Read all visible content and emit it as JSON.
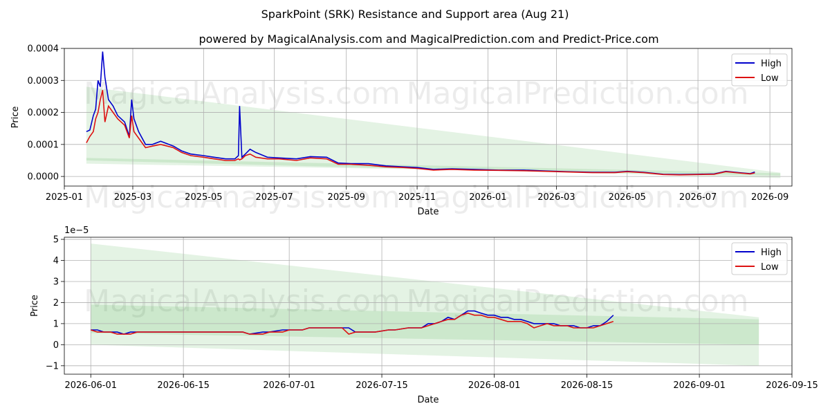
{
  "title": "SparkPoint (SRK) Resistance and Support area (Aug 21)",
  "subtitle": "powered by MagicalAnalysis.com and MagicalPrediction.com and Predict-Price.com",
  "watermarks": [
    "MagicalAnalysis.com",
    "MagicalPrediction.com"
  ],
  "colors": {
    "high": "#0000cc",
    "low": "#dd1111",
    "band": "#2ca02c",
    "grid": "#b0b0b0"
  },
  "chart_data": [
    {
      "type": "line",
      "xlabel": "Date",
      "ylabel": "Price",
      "grid": true,
      "legend": "top-right",
      "xlim": [
        "2025-01-01",
        "2026-09-20"
      ],
      "ylim": [
        -3e-05,
        0.0004
      ],
      "xticks": [
        "2025-01",
        "2025-03",
        "2025-05",
        "2025-07",
        "2025-09",
        "2025-11",
        "2026-01",
        "2026-03",
        "2026-05",
        "2026-07",
        "2026-09"
      ],
      "yticks": [
        {
          "value": 0.0,
          "label": "0.0000"
        },
        {
          "value": 0.0001,
          "label": "0.0001"
        },
        {
          "value": 0.0002,
          "label": "0.0002"
        },
        {
          "value": 0.0003,
          "label": "0.0003"
        },
        {
          "value": 0.0004,
          "label": "0.0004"
        }
      ],
      "bands": [
        {
          "x": [
            "2025-01-20",
            "2026-09-10"
          ],
          "upper": [
            0.00028,
            1.2e-05
          ],
          "lower": [
            5e-05,
            -5e-06
          ]
        },
        {
          "x": [
            "2025-01-20",
            "2026-09-10"
          ],
          "upper": [
            5.8e-05,
            1e-05
          ],
          "lower": [
            4e-05,
            3e-06
          ]
        }
      ],
      "series": [
        {
          "name": "High",
          "x": [
            "2025-01-20",
            "2025-01-23",
            "2025-01-26",
            "2025-01-28",
            "2025-01-30",
            "2025-02-01",
            "2025-02-03",
            "2025-02-05",
            "2025-02-08",
            "2025-02-12",
            "2025-02-16",
            "2025-02-22",
            "2025-02-26",
            "2025-02-28",
            "2025-03-02",
            "2025-03-06",
            "2025-03-12",
            "2025-03-18",
            "2025-03-25",
            "2025-04-05",
            "2025-04-12",
            "2025-04-20",
            "2025-05-01",
            "2025-05-10",
            "2025-05-20",
            "2025-05-28",
            "2025-05-31",
            "2025-06-01",
            "2025-06-03",
            "2025-06-06",
            "2025-06-10",
            "2025-06-15",
            "2025-06-25",
            "2025-07-05",
            "2025-07-20",
            "2025-08-01",
            "2025-08-15",
            "2025-08-25",
            "2025-09-05",
            "2025-09-20",
            "2025-10-05",
            "2025-10-20",
            "2025-11-01",
            "2025-11-15",
            "2025-12-01",
            "2025-12-20",
            "2026-01-10",
            "2026-02-01",
            "2026-02-20",
            "2026-03-10",
            "2026-04-01",
            "2026-04-20",
            "2026-05-01",
            "2026-05-15",
            "2026-06-01",
            "2026-06-15",
            "2026-07-01",
            "2026-07-15",
            "2026-07-25",
            "2026-08-05",
            "2026-08-15",
            "2026-08-19"
          ],
          "values": [
            0.00014,
            0.000145,
            0.00019,
            0.00021,
            0.0003,
            0.00028,
            0.00039,
            0.00031,
            0.00024,
            0.00022,
            0.00019,
            0.00017,
            0.000125,
            0.00024,
            0.00018,
            0.00014,
            0.0001,
            0.0001,
            0.00011,
            9.5e-05,
            8e-05,
            7e-05,
            6.5e-05,
            6e-05,
            5.5e-05,
            5.5e-05,
            6.5e-05,
            0.00022,
            6e-05,
            7e-05,
            8.5e-05,
            7.5e-05,
            6e-05,
            5.8e-05,
            5.5e-05,
            6.2e-05,
            6e-05,
            4.2e-05,
            4e-05,
            4e-05,
            3.3e-05,
            3e-05,
            2.8e-05,
            2.2e-05,
            2.4e-05,
            2.2e-05,
            2e-05,
            2e-05,
            1.7e-05,
            1.5e-05,
            1.3e-05,
            1.3e-05,
            1.6e-05,
            1.3e-05,
            7e-06,
            6e-06,
            7e-06,
            8e-06,
            1.6e-05,
            1.2e-05,
            9e-06,
            1.4e-05
          ]
        },
        {
          "name": "Low",
          "x": [
            "2025-01-20",
            "2025-01-23",
            "2025-01-26",
            "2025-01-28",
            "2025-01-30",
            "2025-02-01",
            "2025-02-03",
            "2025-02-05",
            "2025-02-08",
            "2025-02-12",
            "2025-02-16",
            "2025-02-22",
            "2025-02-26",
            "2025-02-28",
            "2025-03-02",
            "2025-03-06",
            "2025-03-12",
            "2025-03-18",
            "2025-03-25",
            "2025-04-05",
            "2025-04-12",
            "2025-04-20",
            "2025-05-01",
            "2025-05-10",
            "2025-05-20",
            "2025-05-28",
            "2025-05-31",
            "2025-06-01",
            "2025-06-03",
            "2025-06-06",
            "2025-06-10",
            "2025-06-15",
            "2025-06-25",
            "2025-07-05",
            "2025-07-20",
            "2025-08-01",
            "2025-08-15",
            "2025-08-25",
            "2025-09-05",
            "2025-09-20",
            "2025-10-05",
            "2025-10-20",
            "2025-11-01",
            "2025-11-15",
            "2025-12-01",
            "2025-12-20",
            "2026-01-10",
            "2026-02-01",
            "2026-02-20",
            "2026-03-10",
            "2026-04-01",
            "2026-04-20",
            "2026-05-01",
            "2026-05-15",
            "2026-06-01",
            "2026-06-15",
            "2026-07-01",
            "2026-07-15",
            "2026-07-25",
            "2026-08-05",
            "2026-08-15",
            "2026-08-19"
          ],
          "values": [
            0.000105,
            0.000125,
            0.00014,
            0.00018,
            0.0002,
            0.00024,
            0.00027,
            0.00017,
            0.00022,
            0.0002,
            0.00018,
            0.00016,
            0.00012,
            0.00019,
            0.00014,
            0.00012,
            9e-05,
            9.5e-05,
            0.0001,
            9e-05,
            7.5e-05,
            6.5e-05,
            6e-05,
            5.5e-05,
            5e-05,
            5e-05,
            5.5e-05,
            5.2e-05,
            5.5e-05,
            6.5e-05,
            7e-05,
            6e-05,
            5.5e-05,
            5.5e-05,
            5e-05,
            5.8e-05,
            5.5e-05,
            3.8e-05,
            3.8e-05,
            3.5e-05,
            3e-05,
            2.8e-05,
            2.5e-05,
            2e-05,
            2.2e-05,
            2e-05,
            1.9e-05,
            1.8e-05,
            1.6e-05,
            1.4e-05,
            1.2e-05,
            1.2e-05,
            1.5e-05,
            1.2e-05,
            6e-06,
            5e-06,
            6e-06,
            7e-06,
            1.5e-05,
            1.1e-05,
            8e-06,
            1.1e-05
          ]
        }
      ]
    },
    {
      "type": "line",
      "xlabel": "Date",
      "ylabel": "Price",
      "grid": true,
      "legend": "top-right",
      "y_multiplier": "1e−5",
      "xlim": [
        "2026-05-28",
        "2026-09-15"
      ],
      "ylim": [
        -1.4,
        5.1
      ],
      "xticks": [
        "2026-06-01",
        "2026-06-15",
        "2026-07-01",
        "2026-07-15",
        "2026-08-01",
        "2026-08-15",
        "2026-09-01",
        "2026-09-15"
      ],
      "yticks": [
        {
          "value": -1,
          "label": "−1"
        },
        {
          "value": 0,
          "label": "0"
        },
        {
          "value": 1,
          "label": "1"
        },
        {
          "value": 2,
          "label": "2"
        },
        {
          "value": 3,
          "label": "3"
        },
        {
          "value": 4,
          "label": "4"
        },
        {
          "value": 5,
          "label": "5"
        }
      ],
      "bands": [
        {
          "x": [
            "2026-06-01",
            "2026-09-10"
          ],
          "upper": [
            4.8,
            1.3
          ],
          "lower": [
            0.0,
            -1.0
          ]
        },
        {
          "x": [
            "2026-06-01",
            "2026-09-10"
          ],
          "upper": [
            1.9,
            1.2
          ],
          "lower": [
            0.55,
            0.0
          ]
        }
      ],
      "series": [
        {
          "name": "High",
          "x": [
            "2026-06-01",
            "2026-06-02",
            "2026-06-03",
            "2026-06-04",
            "2026-06-05",
            "2026-06-06",
            "2026-06-07",
            "2026-06-08",
            "2026-06-10",
            "2026-06-15",
            "2026-06-20",
            "2026-06-24",
            "2026-06-25",
            "2026-06-27",
            "2026-06-28",
            "2026-06-30",
            "2026-07-01",
            "2026-07-03",
            "2026-07-04",
            "2026-07-06",
            "2026-07-09",
            "2026-07-10",
            "2026-07-11",
            "2026-07-13",
            "2026-07-14",
            "2026-07-16",
            "2026-07-17",
            "2026-07-19",
            "2026-07-20",
            "2026-07-21",
            "2026-07-22",
            "2026-07-23",
            "2026-07-24",
            "2026-07-25",
            "2026-07-26",
            "2026-07-27",
            "2026-07-28",
            "2026-07-29",
            "2026-07-30",
            "2026-07-31",
            "2026-08-01",
            "2026-08-02",
            "2026-08-03",
            "2026-08-04",
            "2026-08-05",
            "2026-08-06",
            "2026-08-07",
            "2026-08-08",
            "2026-08-09",
            "2026-08-10",
            "2026-08-11",
            "2026-08-12",
            "2026-08-13",
            "2026-08-14",
            "2026-08-15",
            "2026-08-16",
            "2026-08-17",
            "2026-08-18",
            "2026-08-19"
          ],
          "values": [
            0.7,
            0.7,
            0.6,
            0.6,
            0.6,
            0.5,
            0.6,
            0.6,
            0.6,
            0.6,
            0.6,
            0.6,
            0.5,
            0.6,
            0.6,
            0.7,
            0.7,
            0.7,
            0.8,
            0.8,
            0.8,
            0.8,
            0.6,
            0.6,
            0.6,
            0.7,
            0.7,
            0.8,
            0.8,
            0.8,
            1.0,
            1.0,
            1.1,
            1.3,
            1.2,
            1.4,
            1.6,
            1.6,
            1.5,
            1.4,
            1.4,
            1.3,
            1.3,
            1.2,
            1.2,
            1.1,
            1.0,
            1.0,
            1.0,
            1.0,
            0.9,
            0.9,
            0.9,
            0.8,
            0.8,
            0.9,
            0.9,
            1.1,
            1.4
          ]
        },
        {
          "name": "Low",
          "x": [
            "2026-06-01",
            "2026-06-02",
            "2026-06-03",
            "2026-06-04",
            "2026-06-05",
            "2026-06-06",
            "2026-06-07",
            "2026-06-08",
            "2026-06-10",
            "2026-06-15",
            "2026-06-20",
            "2026-06-24",
            "2026-06-25",
            "2026-06-27",
            "2026-06-28",
            "2026-06-30",
            "2026-07-01",
            "2026-07-03",
            "2026-07-04",
            "2026-07-06",
            "2026-07-09",
            "2026-07-10",
            "2026-07-11",
            "2026-07-13",
            "2026-07-14",
            "2026-07-16",
            "2026-07-17",
            "2026-07-19",
            "2026-07-20",
            "2026-07-21",
            "2026-07-22",
            "2026-07-23",
            "2026-07-24",
            "2026-07-25",
            "2026-07-26",
            "2026-07-27",
            "2026-07-28",
            "2026-07-29",
            "2026-07-30",
            "2026-07-31",
            "2026-08-01",
            "2026-08-02",
            "2026-08-03",
            "2026-08-04",
            "2026-08-05",
            "2026-08-06",
            "2026-08-07",
            "2026-08-08",
            "2026-08-09",
            "2026-08-10",
            "2026-08-11",
            "2026-08-12",
            "2026-08-13",
            "2026-08-14",
            "2026-08-15",
            "2026-08-16",
            "2026-08-17",
            "2026-08-18",
            "2026-08-19"
          ],
          "values": [
            0.7,
            0.6,
            0.6,
            0.6,
            0.5,
            0.5,
            0.5,
            0.6,
            0.6,
            0.6,
            0.6,
            0.6,
            0.5,
            0.5,
            0.6,
            0.6,
            0.7,
            0.7,
            0.8,
            0.8,
            0.8,
            0.5,
            0.6,
            0.6,
            0.6,
            0.7,
            0.7,
            0.8,
            0.8,
            0.8,
            0.9,
            1.0,
            1.1,
            1.2,
            1.2,
            1.4,
            1.5,
            1.4,
            1.4,
            1.3,
            1.3,
            1.2,
            1.1,
            1.1,
            1.1,
            1.0,
            0.8,
            0.9,
            1.0,
            0.9,
            0.9,
            0.9,
            0.8,
            0.8,
            0.8,
            0.8,
            0.9,
            1.0,
            1.1
          ]
        }
      ]
    }
  ]
}
